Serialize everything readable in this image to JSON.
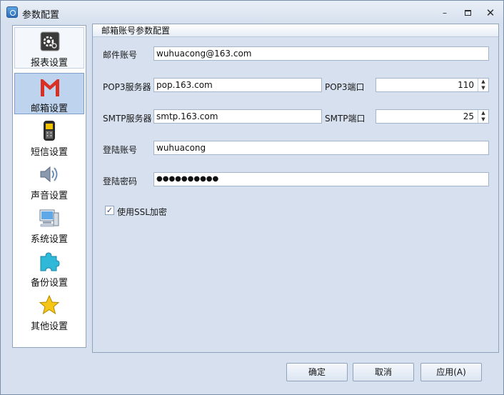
{
  "window": {
    "title": "参数配置",
    "controls": {
      "minimize": "–",
      "close": "✕"
    }
  },
  "sidebar": {
    "items": [
      {
        "label": "报表设置",
        "icon": "gear-report-icon"
      },
      {
        "label": "邮箱设置",
        "icon": "gmail-icon"
      },
      {
        "label": "短信设置",
        "icon": "mobile-phone-icon"
      },
      {
        "label": "声音设置",
        "icon": "speaker-icon"
      },
      {
        "label": "系统设置",
        "icon": "computer-icon"
      },
      {
        "label": "备份设置",
        "icon": "puzzle-icon"
      },
      {
        "label": "其他设置",
        "icon": "star-icon"
      }
    ],
    "selected_index": 1
  },
  "panel": {
    "header": "邮箱账号参数配置",
    "email_label": "邮件账号",
    "email_value": "wuhuacong@163.com",
    "pop3_server_label": "POP3服务器",
    "pop3_server_value": "pop.163.com",
    "pop3_port_label": "POP3端口",
    "pop3_port_value": "110",
    "smtp_server_label": "SMTP服务器",
    "smtp_server_value": "smtp.163.com",
    "smtp_port_label": "SMTP端口",
    "smtp_port_value": "25",
    "login_account_label": "登陆账号",
    "login_account_value": "wuhuacong",
    "login_password_label": "登陆密码",
    "login_password_value": "●●●●●●●●●●",
    "ssl_label": "使用SSL加密",
    "ssl_checked": true,
    "ssl_mark": "✓"
  },
  "buttons": {
    "ok": "确定",
    "cancel": "取消",
    "apply": "应用(A)"
  },
  "colors": {
    "window_bg": "#d6e0ee",
    "selected_bg": "#bed3ee",
    "gmail_red": "#d93025"
  }
}
